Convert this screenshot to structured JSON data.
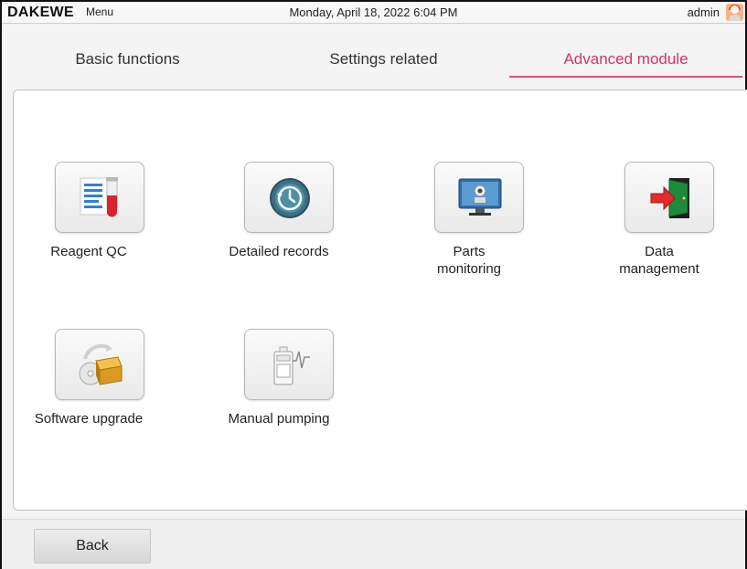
{
  "header": {
    "brand": "DAKEWE",
    "menu_label": "Menu",
    "datetime": "Monday, April 18, 2022  6:04 PM",
    "user": "admin",
    "avatar_icon": "user-avatar-icon"
  },
  "tabs": [
    {
      "label": "Basic functions",
      "active": false
    },
    {
      "label": "Settings related",
      "active": false
    },
    {
      "label": "Advanced module",
      "active": true
    }
  ],
  "colors": {
    "active_tab": "#d6336c",
    "active_underline": "#e04e80"
  },
  "modules": [
    {
      "label": "Reagent QC",
      "icon": "reagent-qc-icon"
    },
    {
      "label": "Detailed records",
      "icon": "clock-history-icon"
    },
    {
      "label_line1": "Parts",
      "label_line2": "monitoring",
      "icon": "monitor-camera-icon"
    },
    {
      "label_line1": "Data",
      "label_line2": "management",
      "icon": "door-arrow-icon"
    },
    {
      "label": "Software upgrade",
      "icon": "package-disc-icon"
    },
    {
      "label": "Manual pumping",
      "icon": "analyzer-pulse-icon"
    }
  ],
  "footer": {
    "back_label": "Back"
  }
}
